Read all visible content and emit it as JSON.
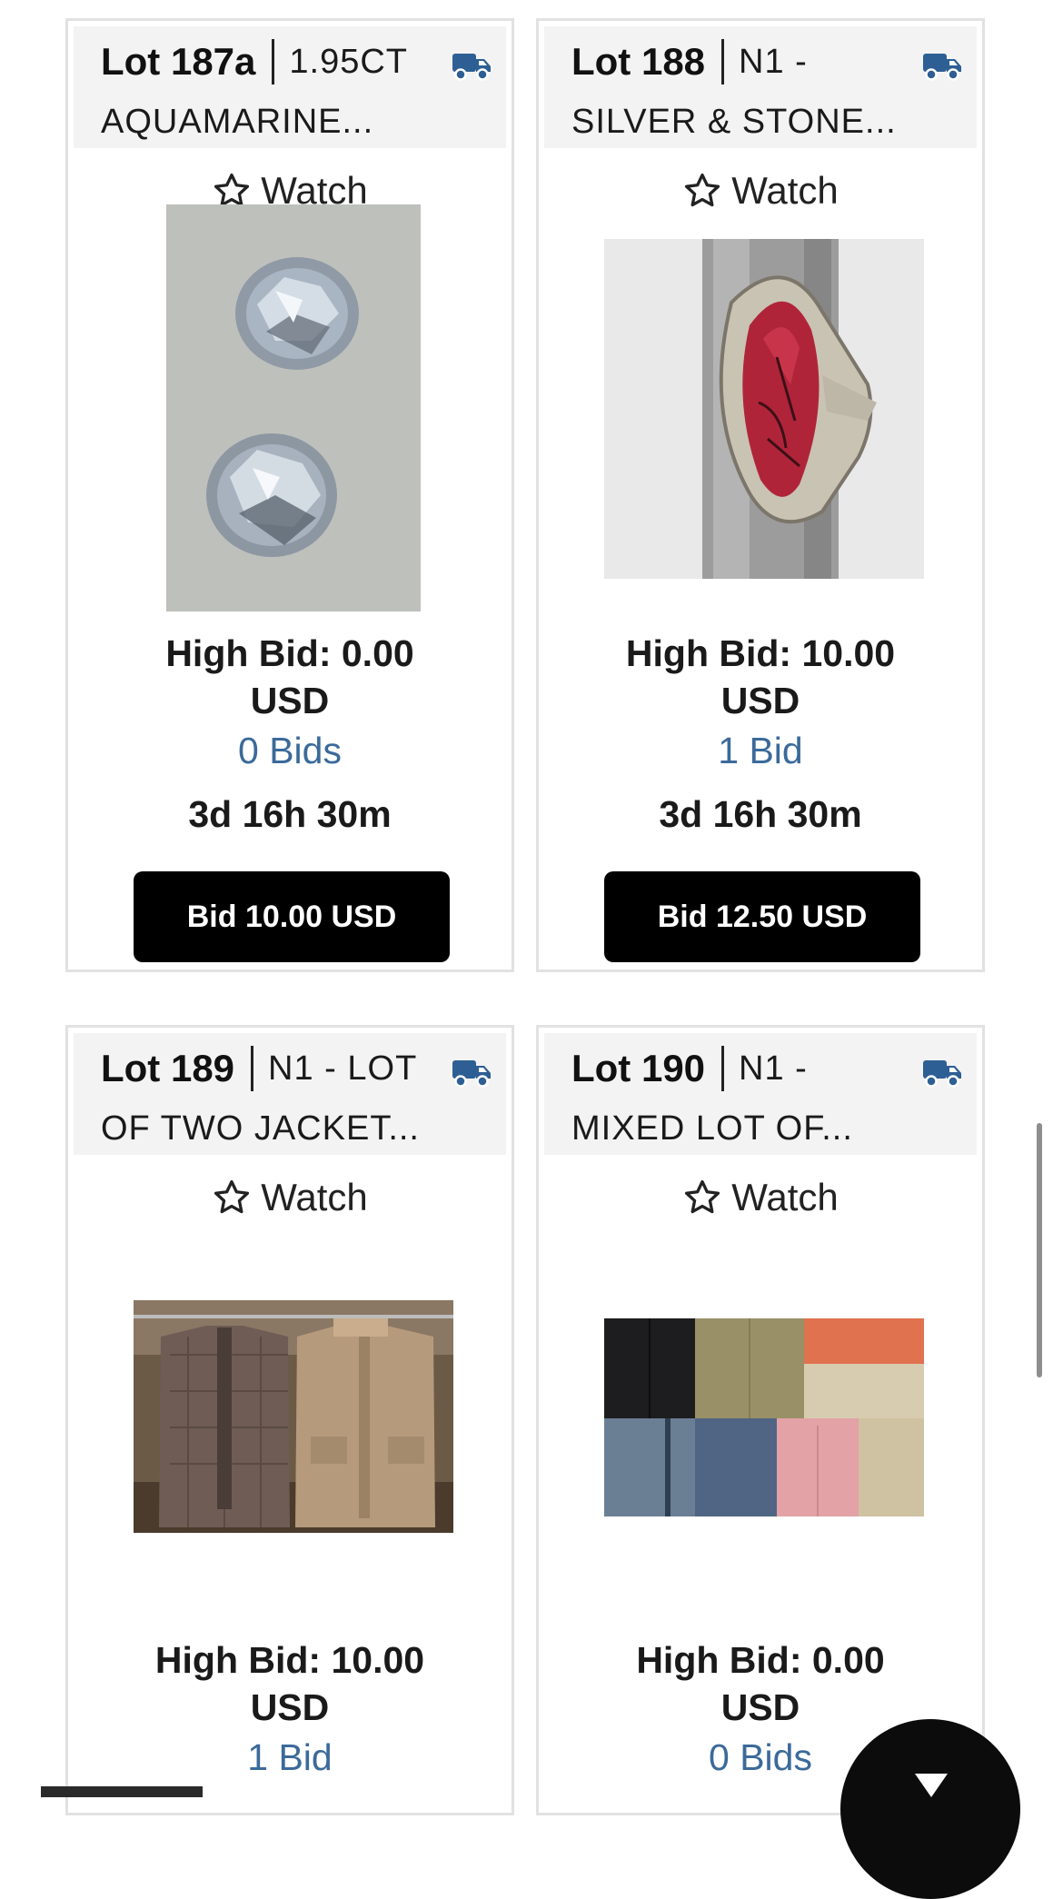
{
  "lots": [
    {
      "lot_number": "Lot 187a",
      "title_line1": "1.95CT",
      "title_line2": "AQUAMARINE...",
      "watch_label": "Watch",
      "image": "aquamarine-gemstones",
      "high_bid_line1": "High Bid: 0.00",
      "high_bid_line2": "USD",
      "bids": "0 Bids",
      "time_left": "3d 16h 30m",
      "bid_button": "Bid 10.00 USD"
    },
    {
      "lot_number": "Lot 188",
      "title_line1": "N1 -",
      "title_line2": "SILVER & STONE...",
      "watch_label": "Watch",
      "image": "silver-ring-red-stone",
      "high_bid_line1": "High Bid: 10.00",
      "high_bid_line2": "USD",
      "bids": "1 Bid",
      "time_left": "3d 16h 30m",
      "bid_button": "Bid 12.50 USD"
    },
    {
      "lot_number": "Lot 189",
      "title_line1": "N1 - LOT",
      "title_line2": "OF TWO JACKET...",
      "watch_label": "Watch",
      "image": "two-jackets",
      "high_bid_line1": "High Bid: 10.00",
      "high_bid_line2": "USD",
      "bids": "1 Bid"
    },
    {
      "lot_number": "Lot 190",
      "title_line1": "N1 -",
      "title_line2": "MIXED LOT OF...",
      "watch_label": "Watch",
      "image": "mixed-clothing",
      "high_bid_line1": "High Bid: 0.00",
      "high_bid_line2": "USD",
      "bids": "0 Bids"
    }
  ],
  "icons": {
    "shipping": "truck-icon",
    "watch": "star-outline-icon",
    "fab": "chevron-down-icon"
  },
  "colors": {
    "accent_blue": "#3b6a9a",
    "truck_blue": "#2d5f94",
    "button_bg": "#000000",
    "header_bg": "#f3f3f3"
  }
}
